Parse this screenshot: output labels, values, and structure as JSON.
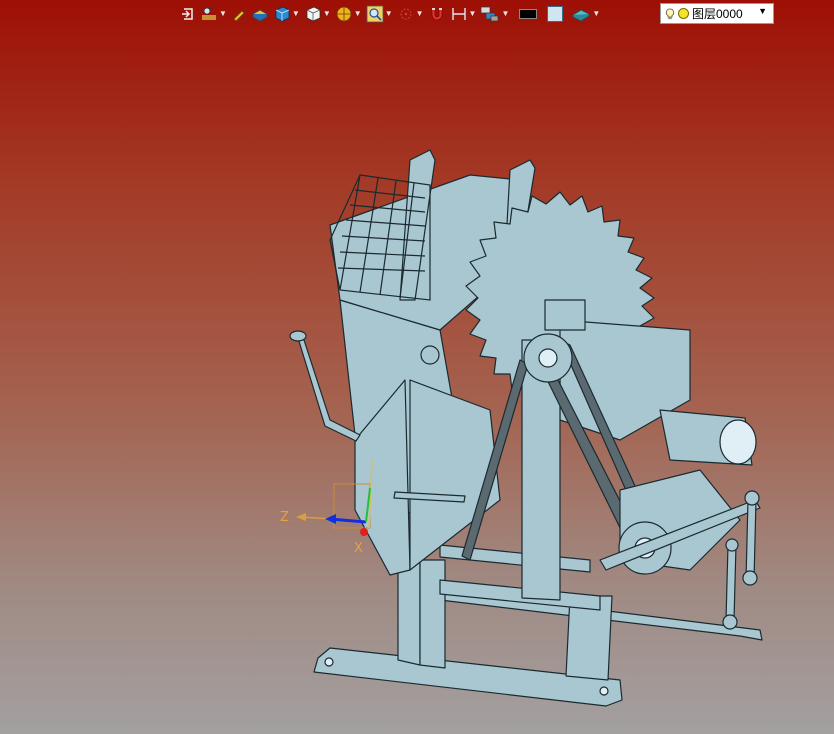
{
  "toolbar": {
    "items": [
      {
        "name": "exit-group-icon",
        "has_caret": false
      },
      {
        "name": "sketch-tools-icon",
        "has_caret": true
      },
      {
        "name": "pencil-icon",
        "has_caret": false
      },
      {
        "name": "plane-icon",
        "has_caret": false
      },
      {
        "name": "solid-box-icon",
        "has_caret": true
      },
      {
        "name": "view-cube-icon",
        "has_caret": true
      },
      {
        "name": "render-style-icon",
        "has_caret": true
      },
      {
        "name": "zoom-view-icon",
        "has_caret": true
      },
      {
        "name": "snap-point-icon",
        "has_caret": true
      },
      {
        "name": "magnet-icon",
        "has_caret": false
      },
      {
        "name": "dimension-icon",
        "has_caret": true
      },
      {
        "name": "layers-stack-icon",
        "has_caret": true
      },
      {
        "name": "line-color-swatch",
        "has_caret": false
      },
      {
        "name": "fill-color-swatch",
        "has_caret": false
      },
      {
        "name": "material-icon",
        "has_caret": true
      }
    ],
    "line_color": "#000000",
    "fill_color": "#cfe6f0"
  },
  "layer": {
    "current": "图层0000"
  },
  "triad": {
    "z_label": "Z",
    "x_label": "X",
    "y_label": ""
  },
  "model": {
    "fill_color": "#a9c7d1",
    "edge_color": "#1a2a30"
  },
  "background": {
    "top": "#9e0f05",
    "bottom": "#a3a0a0"
  }
}
